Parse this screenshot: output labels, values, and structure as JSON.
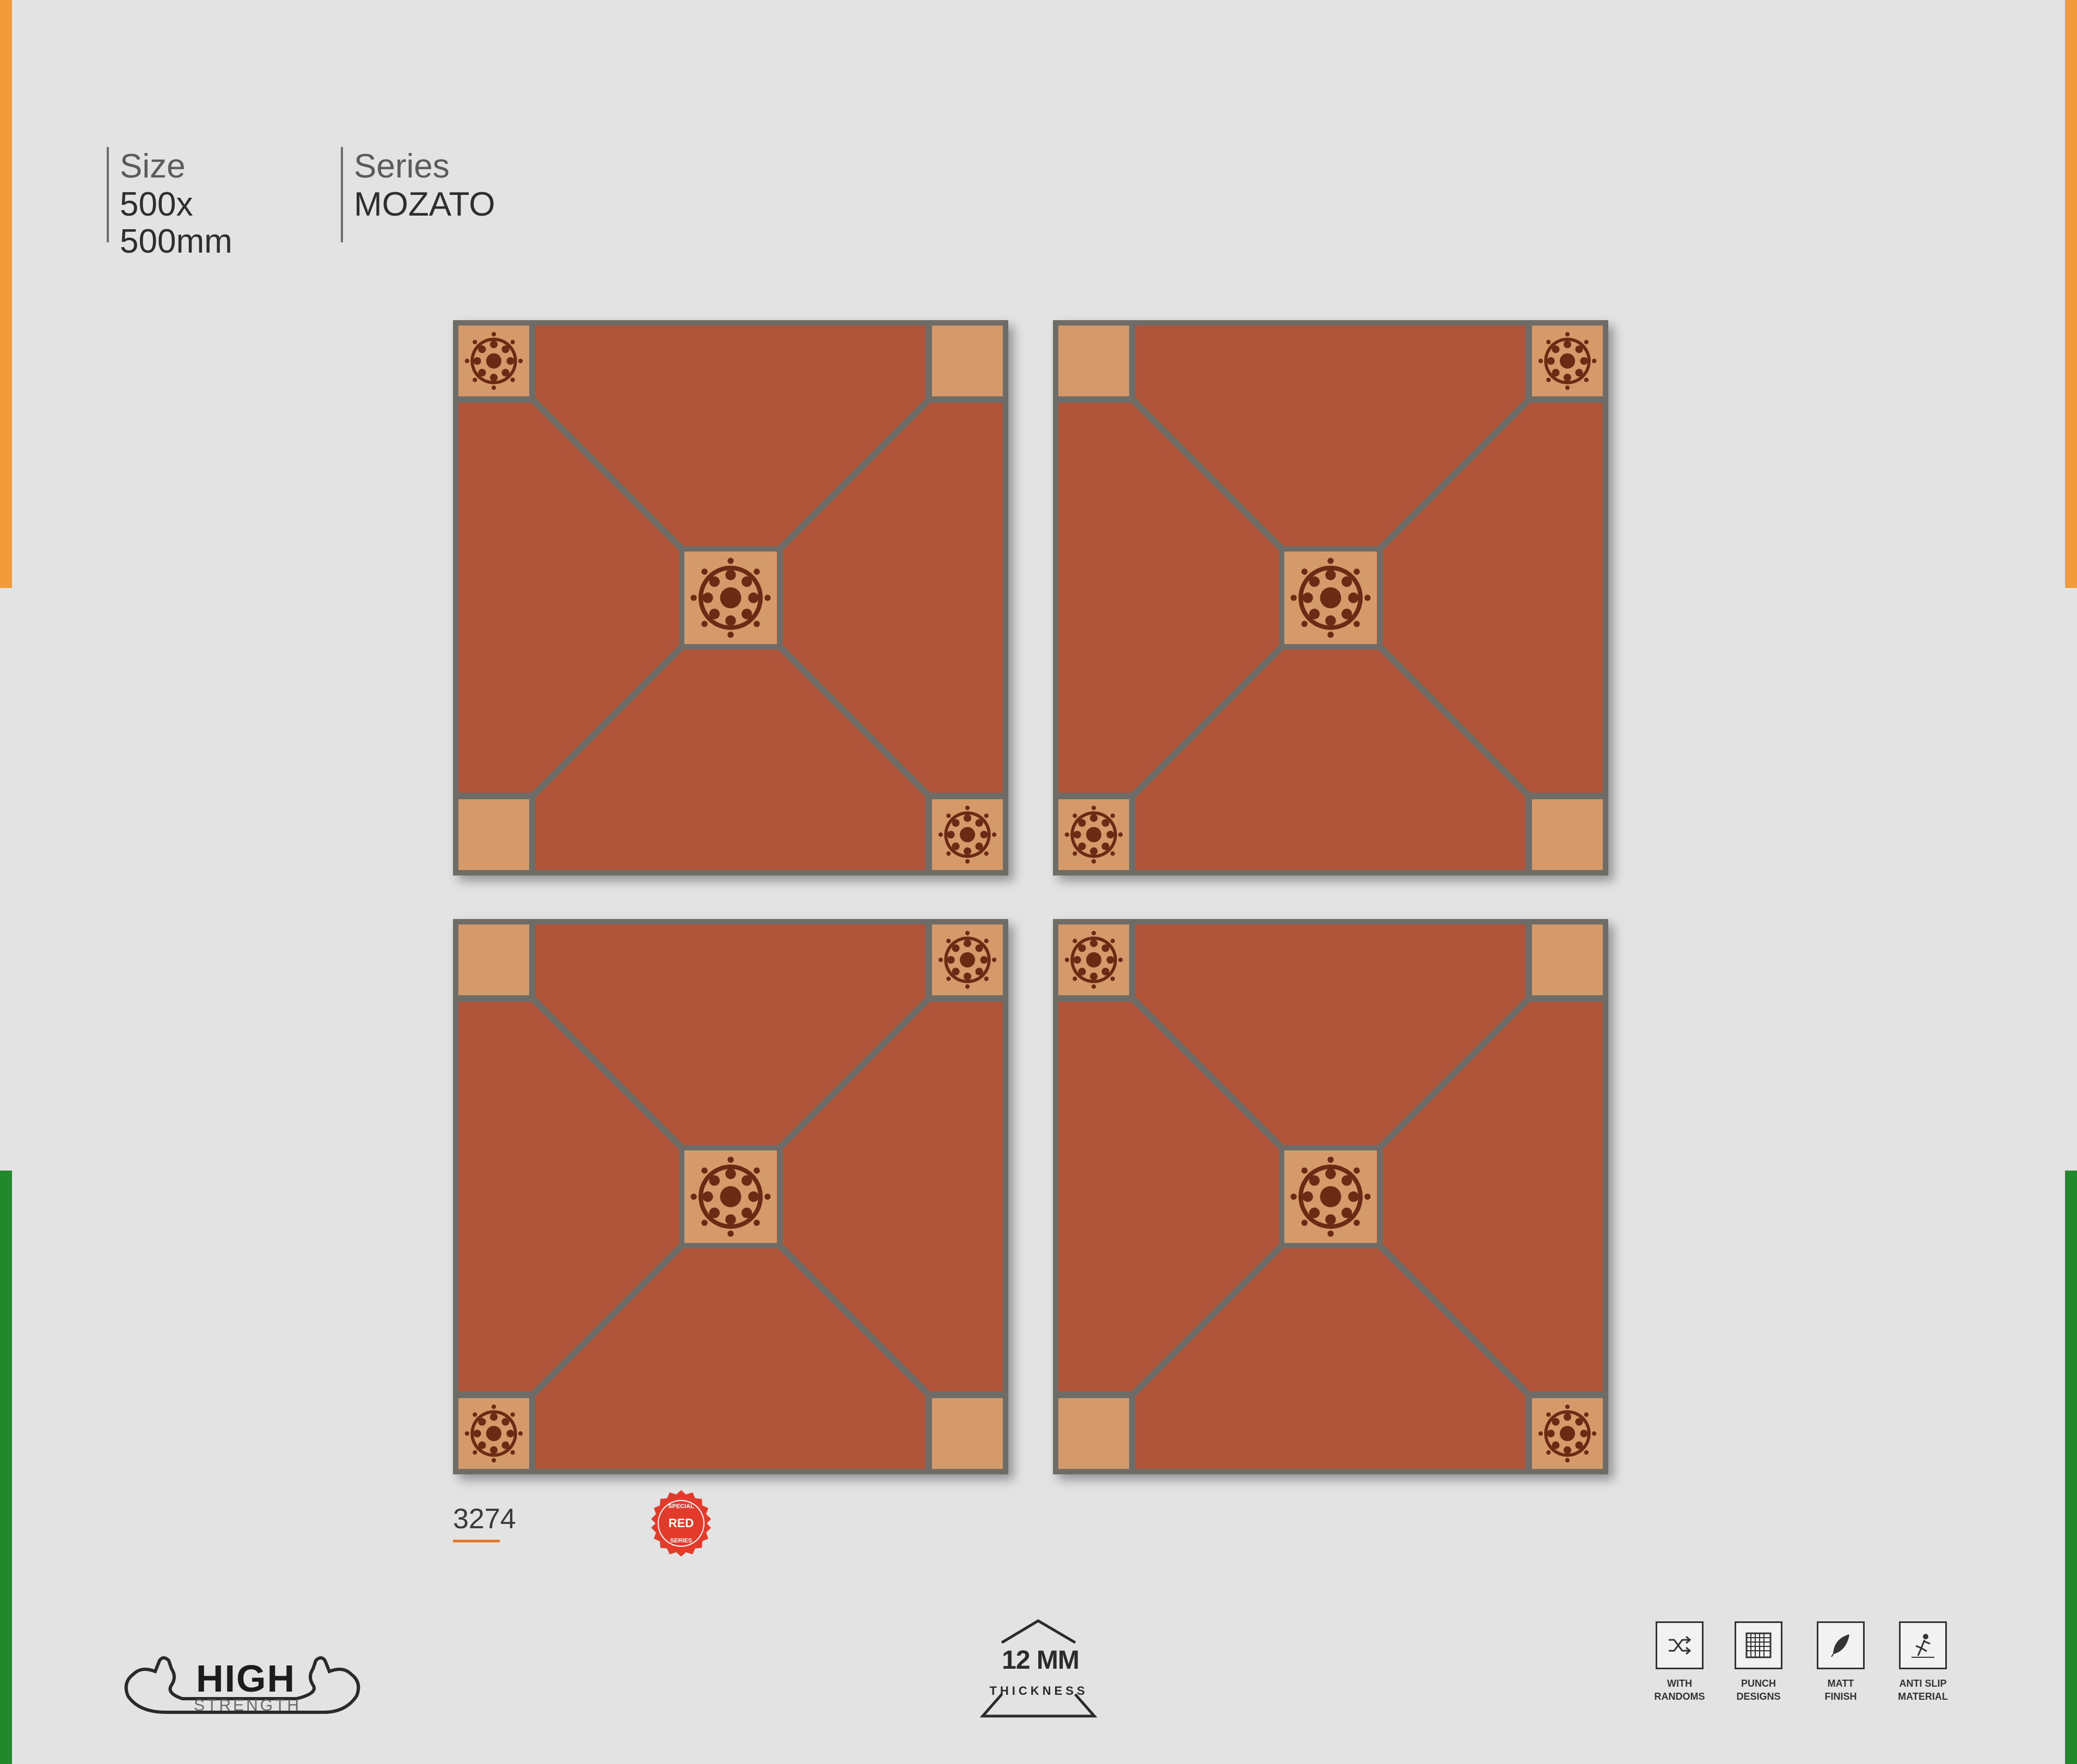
{
  "colors": {
    "background": "#e3e3e3",
    "flag_orange": "#f39a3b",
    "flag_green": "#21892b",
    "terracotta": "#b0553a",
    "grout": "#6f6b66",
    "beige_insert": "#d59a6a"
  },
  "specs": {
    "size_label": "Size",
    "size_value": "500x 500mm",
    "series_label": "Series",
    "series_value": "MOZATO"
  },
  "product": {
    "code": "3274",
    "badge": {
      "top_text": "SPECIAL",
      "center_text": "RED",
      "bottom_text": "SERIES"
    }
  },
  "tiles": [
    {
      "name": "tile-top-left"
    },
    {
      "name": "tile-top-right"
    },
    {
      "name": "tile-bottom-left"
    },
    {
      "name": "tile-bottom-right"
    }
  ],
  "footer": {
    "strength_logo": {
      "line1": "HIGH",
      "line2": "STRENGTH",
      "icon": "flexed-arm-icon"
    },
    "thickness": {
      "value": "12 MM",
      "label": "THICKNESS",
      "icon": "triangle-icon"
    },
    "features": [
      {
        "icon": "shuffle-icon",
        "line1": "WITH",
        "line2": "RANDOMS"
      },
      {
        "icon": "grid-icon",
        "line1": "PUNCH",
        "line2": "DESIGNS"
      },
      {
        "icon": "feather-icon",
        "line1": "MATT",
        "line2": "FINISH"
      },
      {
        "icon": "slip-icon",
        "line1": "ANTI SLIP",
        "line2": "MATERIAL"
      }
    ]
  }
}
